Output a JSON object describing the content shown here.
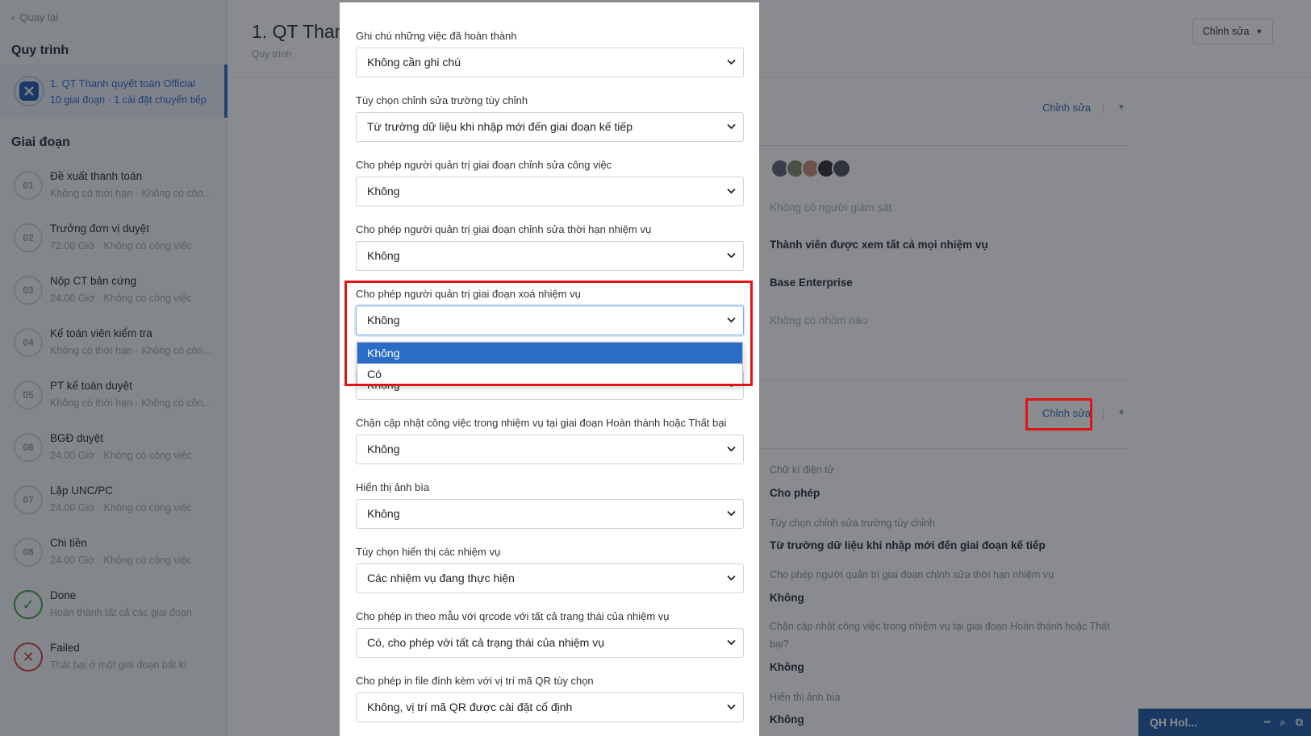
{
  "sidebar": {
    "back_label": "Quay lại",
    "process_heading": "Quy trình",
    "process": {
      "name": "1. QT Thanh quyết toán Official",
      "sub": "10 giai đoạn · 1 cài đặt chuyển tiếp"
    },
    "stages_heading": "Giai đoạn",
    "stages": [
      {
        "num": "01",
        "name": "Đề xuất thanh toán",
        "sub": "Không có thời hạn · Không có côn..."
      },
      {
        "num": "02",
        "name": "Trưởng đơn vị duyệt",
        "sub": "72.00 Giờ · Không có công việc"
      },
      {
        "num": "03",
        "name": "Nộp CT bản cứng",
        "sub": "24.00 Giờ · Không có công việc"
      },
      {
        "num": "04",
        "name": "Kế toán viên kiểm tra",
        "sub": "Không có thời hạn · Không có côn..."
      },
      {
        "num": "05",
        "name": "PT kế toán duyệt",
        "sub": "Không có thời hạn · Không có côn..."
      },
      {
        "num": "06",
        "name": "BGĐ duyệt",
        "sub": "24.00 Giờ · Không có công việc"
      },
      {
        "num": "07",
        "name": "Lập UNC/PC",
        "sub": "24.00 Giờ · Không có công việc"
      },
      {
        "num": "08",
        "name": "Chi tiền",
        "sub": "24.00 Giờ · Không có công việc"
      },
      {
        "num": "✓",
        "name": "Done",
        "sub": "Hoàn thành tất cả các giai đoạn"
      },
      {
        "num": "✕",
        "name": "Failed",
        "sub": "Thất bại ở một giai đoạn bất kì"
      }
    ]
  },
  "main": {
    "title": "1. QT Than",
    "subtitle": "Quy trình",
    "edit_button": "Chỉnh sửa",
    "section1_edit": "Chỉnh sửa",
    "section2_edit": "Chỉnh sửa",
    "supervisor_text": "Không có người giám sát",
    "members_text": "Thành viên được xem tất cả mọi nhiệm vụ",
    "org_text": "Base Enterprise",
    "group_text": "Không có nhóm nào",
    "details": [
      {
        "label": "Chữ kí điện tử",
        "value": "Cho phép"
      },
      {
        "label": "Tùy chọn chỉnh sửa trường tùy chỉnh",
        "value": "Từ trường dữ liệu khi nhập mới đến giai đoạn kế tiếp"
      },
      {
        "label": "Cho phép người quản trị giai đoạn chỉnh sửa thời hạn nhiệm vụ",
        "value": "Không"
      },
      {
        "label_line1": "Chặn cập nhật công việc trong nhiệm vụ tại giai đoạn Hoàn thành hoặc Thất",
        "label_line2": "bại?",
        "value": "Không"
      },
      {
        "label": "Hiển thị ảnh bìa",
        "value": "Không"
      }
    ]
  },
  "modal": {
    "fields": [
      {
        "label": "Ghi chú những việc đã hoàn thành",
        "value": "Không cần ghi chú"
      },
      {
        "label": "Tùy chọn chỉnh sửa trường tùy chỉnh",
        "value": "Từ trường dữ liệu khi nhập mới đến giai đoạn kế tiếp"
      },
      {
        "label": "Cho phép người quản trị giai đoạn chỉnh sửa công việc",
        "value": "Không"
      },
      {
        "label": "Cho phép người quản trị giai đoạn chỉnh sửa thời hạn nhiệm vụ",
        "value": "Không"
      },
      {
        "label": "Cho phép người quản trị giai đoạn xoá nhiệm vụ",
        "value": "Không"
      },
      {
        "label": "",
        "value": "Không"
      },
      {
        "label": "Chặn cập nhật công việc trong nhiệm vụ tại giai đoạn Hoàn thành hoặc Thất bại",
        "value": "Không"
      },
      {
        "label": "Hiển thị ảnh bìa",
        "value": "Không"
      },
      {
        "label": "Tùy chọn hiển thị các nhiệm vụ",
        "value": "Các nhiệm vụ đang thực hiện"
      },
      {
        "label": "Cho phép in theo mẫu với qrcode với tất cả trạng thái của nhiệm vụ",
        "value": "Có, cho phép với tất cả trạng thái của nhiệm vụ"
      },
      {
        "label": "Cho phép in file đính kèm với vị trí mã QR tùy chọn",
        "value": "Không, vị trí mã QR được cài đặt cố định"
      }
    ],
    "dropdown_options": [
      "Không",
      "Có"
    ]
  },
  "chat": {
    "label": "QH Hol..."
  },
  "colors": {
    "accent": "#2b6cc4",
    "highlight": "#e01414",
    "done": "#3f9b47",
    "fail": "#d23c3c"
  }
}
